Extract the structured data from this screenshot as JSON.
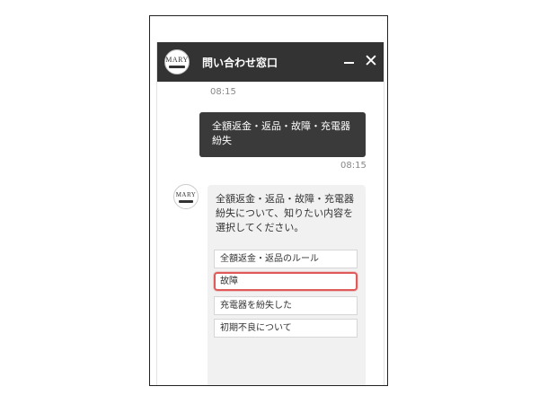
{
  "header": {
    "title": "問い合わせ窓口",
    "logo_text": "MARY",
    "minimize_icon": "minimize-icon",
    "close_icon": "close-icon",
    "close_glyph": "✕",
    "bg_color": "#333333"
  },
  "messages": {
    "first_time": "08:15",
    "user": {
      "text": "全額返金・返品・故障・充電器紛失",
      "time": "08:15",
      "bg_color": "#3a3a3a"
    },
    "bot": {
      "avatar_text": "MARY",
      "text": "全額返金・返品・故障・充電器紛失について、知りたい内容を選択してください。",
      "options": [
        "全額返金・返品のルール",
        "故障",
        "充電器を紛失した",
        "初期不良について"
      ],
      "highlighted_option_index": 1,
      "highlight_color": "#e05a5a",
      "bg_color": "#f1f1f1"
    }
  }
}
